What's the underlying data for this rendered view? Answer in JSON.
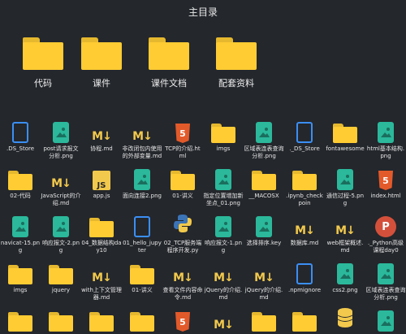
{
  "window_title": "主目录",
  "main_folders": [
    {
      "label": "代码"
    },
    {
      "label": "课件"
    },
    {
      "label": "课件文档"
    },
    {
      "label": "配套资料"
    }
  ],
  "rows": [
    [
      {
        "label": ".DS_Store",
        "icon": "doc-blue"
      },
      {
        "label": "post请求报文分析.png",
        "icon": "image"
      },
      {
        "label": "协程.md",
        "icon": "markdown"
      },
      {
        "label": "非改闭包内使用的外部变量.md",
        "icon": "markdown"
      },
      {
        "label": "TCP的介绍.html",
        "icon": "html"
      },
      {
        "label": "imgs",
        "icon": "folder"
      },
      {
        "label": "区域表连表查询分析.png",
        "icon": "image"
      },
      {
        "label": "._DS_Store",
        "icon": "doc-blue"
      },
      {
        "label": "fontawesome",
        "icon": "folder"
      },
      {
        "label": "html基本结构.png",
        "icon": "image"
      }
    ],
    [
      {
        "label": "02-代码",
        "icon": "folder"
      },
      {
        "label": "JavaScript的介绍.md",
        "icon": "markdown"
      },
      {
        "label": "app.js",
        "icon": "js"
      },
      {
        "label": "面向连接2.png",
        "icon": "image"
      },
      {
        "label": "01-讲义",
        "icon": "folder"
      },
      {
        "label": "指定位置增加新坐点_01.png",
        "icon": "image"
      },
      {
        "label": "__MACOSX",
        "icon": "folder"
      },
      {
        "label": ".ipynb_checkpoin",
        "icon": "folder"
      },
      {
        "label": "通信过程-5.png",
        "icon": "image"
      },
      {
        "label": "index.html",
        "icon": "html"
      }
    ],
    [
      {
        "label": "navicat-15.png",
        "icon": "image"
      },
      {
        "label": "响应报文-2.png",
        "icon": "image"
      },
      {
        "label": "04_数据结构day10",
        "icon": "folder"
      },
      {
        "label": "01_hello_jupyter",
        "icon": "doc-blue"
      },
      {
        "label": "02_TCP服务端程序开发.py",
        "icon": "python"
      },
      {
        "label": "响应报文-1.png",
        "icon": "image"
      },
      {
        "label": "选择排序.key",
        "icon": "image"
      },
      {
        "label": "数据库.md",
        "icon": "markdown"
      },
      {
        "label": "web框架概述.md",
        "icon": "markdown"
      },
      {
        "label": "._Python高级课程day0",
        "icon": "ppt"
      }
    ],
    [
      {
        "label": "imgs",
        "icon": "folder"
      },
      {
        "label": "jquery",
        "icon": "folder"
      },
      {
        "label": "with上下文管理器.md",
        "icon": "markdown"
      },
      {
        "label": "01-讲义",
        "icon": "folder"
      },
      {
        "label": "查看文件内容命令.md",
        "icon": "markdown"
      },
      {
        "label": "jQuery的介绍.md",
        "icon": "markdown"
      },
      {
        "label": "jQuery的介绍.md",
        "icon": "markdown"
      },
      {
        "label": ".npmignore",
        "icon": "doc-blue"
      },
      {
        "label": "css2.png",
        "icon": "image"
      },
      {
        "label": "区域表连表查询分析.png",
        "icon": "image"
      }
    ],
    [
      {
        "label": "",
        "icon": "folder"
      },
      {
        "label": "",
        "icon": "folder"
      },
      {
        "label": "",
        "icon": "folder"
      },
      {
        "label": "",
        "icon": "folder"
      },
      {
        "label": "",
        "icon": "html"
      },
      {
        "label": "",
        "icon": "markdown"
      },
      {
        "label": "",
        "icon": "folder"
      },
      {
        "label": "",
        "icon": "folder"
      },
      {
        "label": "",
        "icon": "database"
      },
      {
        "label": "",
        "icon": "image"
      }
    ]
  ],
  "colors": {
    "background": "#24272c",
    "folder_tab": "#e6b82e",
    "folder_body": "#ffcc33",
    "image_icon": "#2bb89b",
    "doc_icon": "#3b8ff5",
    "markdown": "#f2c94c"
  }
}
